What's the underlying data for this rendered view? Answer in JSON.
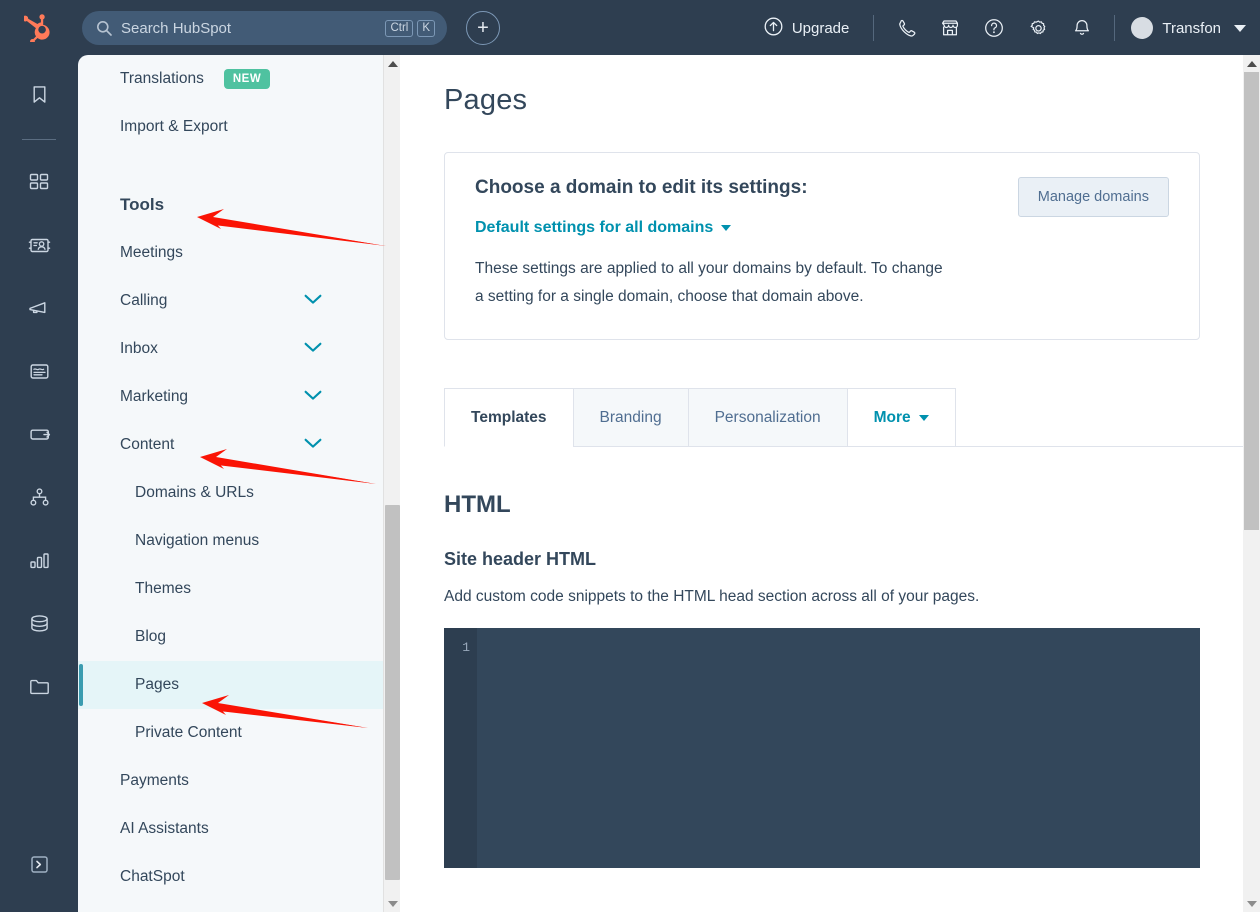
{
  "topbar": {
    "logo": "hubspot-sprocket-logo",
    "search_placeholder": "Search HubSpot",
    "kbd_ctrl": "Ctrl",
    "kbd_k": "K",
    "create_label": "+",
    "upgrade_label": "Upgrade",
    "icons": [
      "phone-icon",
      "marketplace-icon",
      "help-icon",
      "gear-icon",
      "bell-icon"
    ],
    "account_name": "Transfon"
  },
  "rail": {
    "icons": [
      "bookmark-icon",
      "dashboard-grid-icon",
      "contacts-icon",
      "marketing-megaphone-icon",
      "content-icon",
      "commerce-wallet-icon",
      "automation-icon",
      "reporting-bar-icon",
      "data-management-icon",
      "library-folder-icon"
    ],
    "bottom_icon": "developer-console-icon"
  },
  "settings_menu": {
    "items": [
      {
        "label": "Translations",
        "badge": "NEW",
        "type": "item"
      },
      {
        "label": "Import & Export",
        "type": "item"
      },
      {
        "label": "Tools",
        "type": "heading"
      },
      {
        "label": "Meetings",
        "type": "item"
      },
      {
        "label": "Calling",
        "type": "item",
        "chevron": true
      },
      {
        "label": "Inbox",
        "type": "item",
        "chevron": true
      },
      {
        "label": "Marketing",
        "type": "item",
        "chevron": true
      },
      {
        "label": "Content",
        "type": "item",
        "chevron": true
      },
      {
        "label": "Domains & URLs",
        "type": "sub"
      },
      {
        "label": "Navigation menus",
        "type": "sub"
      },
      {
        "label": "Themes",
        "type": "sub"
      },
      {
        "label": "Blog",
        "type": "sub"
      },
      {
        "label": "Pages",
        "type": "sub",
        "active": true
      },
      {
        "label": "Private Content",
        "type": "sub"
      },
      {
        "label": "Payments",
        "type": "item"
      },
      {
        "label": "AI Assistants",
        "type": "item"
      },
      {
        "label": "ChatSpot",
        "type": "item"
      }
    ]
  },
  "main": {
    "page_title": "Pages",
    "domain_card": {
      "title": "Choose a domain to edit its settings:",
      "selected_domain": "Default settings for all domains",
      "description": "These settings are applied to all your domains by default. To change a setting for a single domain, choose that domain above.",
      "manage_button": "Manage domains"
    },
    "tabs": [
      {
        "label": "Templates",
        "active": true
      },
      {
        "label": "Branding",
        "active": false
      },
      {
        "label": "Personalization",
        "active": false
      },
      {
        "label": "More",
        "active": false,
        "dropdown": true
      }
    ],
    "html_section": {
      "heading": "HTML",
      "subheading": "Site header HTML",
      "description": "Add custom code snippets to the HTML head section across all of your pages.",
      "editor_line_number": "1",
      "editor_value": ""
    }
  },
  "colors": {
    "nav_dark": "#2e3e50",
    "brand_orange": "#ff7a59",
    "link_teal": "#0091ae",
    "badge_green": "#4fc2a0",
    "active_bar": "#3a9cb0",
    "active_bg": "#e5f5f8",
    "annotation_red": "#fa1405"
  }
}
